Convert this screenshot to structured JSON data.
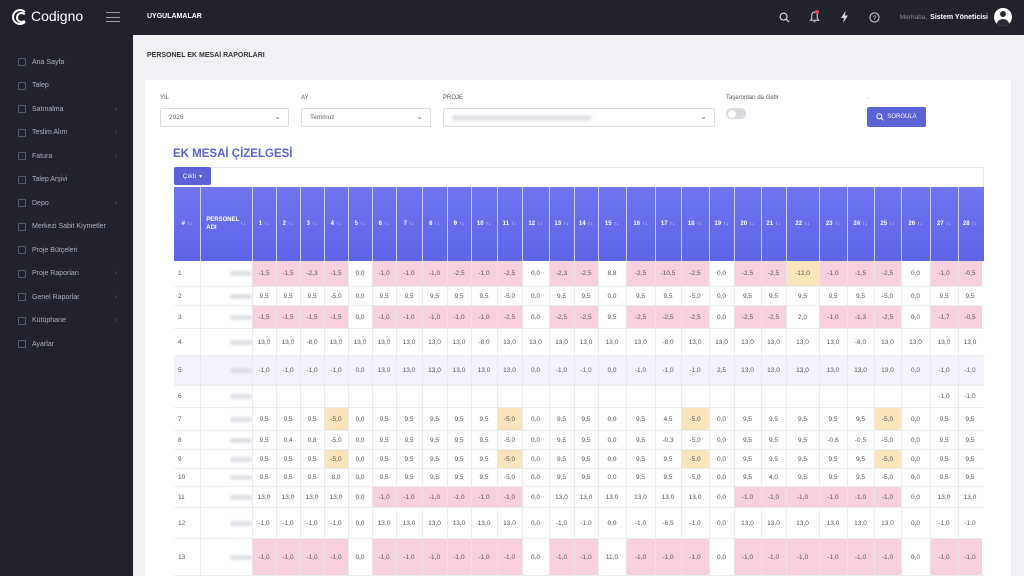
{
  "brand": {
    "name": "Codigno"
  },
  "header": {
    "menu_label": "UYGULAMALAR",
    "greeting": "Merhaba,",
    "user_name": "Sistem Yöneticisi",
    "icons": [
      "search-icon",
      "bell-icon",
      "bolt-icon",
      "help-icon"
    ]
  },
  "sidebar": {
    "items": [
      {
        "label": "Ana Sayfa",
        "has_arrow": false
      },
      {
        "label": "Talep",
        "has_arrow": false
      },
      {
        "label": "Satınalma",
        "has_arrow": true
      },
      {
        "label": "Teslim Alım",
        "has_arrow": true
      },
      {
        "label": "Fatura",
        "has_arrow": true
      },
      {
        "label": "Talep Arşivi",
        "has_arrow": false
      },
      {
        "label": "Depo",
        "has_arrow": true
      },
      {
        "label": "Merkezi Sabit Kıymetler",
        "has_arrow": false
      },
      {
        "label": "Proje Bütçeleri",
        "has_arrow": false
      },
      {
        "label": "Proje Raporları",
        "has_arrow": true
      },
      {
        "label": "Genel Raporlar",
        "has_arrow": true
      },
      {
        "label": "Kütüphane",
        "has_arrow": true
      },
      {
        "label": "Ayarlar",
        "has_arrow": false
      }
    ]
  },
  "page": {
    "title": "PERSONEL EK MESAİ RAPORLARI"
  },
  "filters": {
    "year_label": "YIL",
    "year_value": "2026",
    "month_label": "AY",
    "month_value": "Temmuz",
    "project_label": "PROJE",
    "subcontractor_label": "Taşeronları da Getir",
    "subcontractor_on": false,
    "query_button": "SORGULA"
  },
  "report": {
    "section_title": "EK MESAİ ÇİZELGESİ",
    "export_button": "Çıktı",
    "col_no": "#",
    "col_name": "PERSONEL ADI",
    "days": [
      "1",
      "2",
      "3",
      "4",
      "5",
      "6",
      "7",
      "8",
      "9",
      "10",
      "11",
      "12",
      "13",
      "14",
      "15",
      "16",
      "17",
      "18",
      "19",
      "20",
      "21",
      "22",
      "23",
      "24",
      "25",
      "26",
      "27",
      "28"
    ],
    "rows": [
      {
        "no": "1",
        "v": [
          "-1,5",
          "-1,5",
          "-2,3",
          "-1,5",
          "0,0",
          "-1,0",
          "-1,0",
          "-1,0",
          "-2,5",
          "-1,0",
          "-2,5",
          "0,0",
          "-2,3",
          "-2,5",
          "8,8",
          "-2,5",
          "-10,5",
          "-2,5",
          "0,0",
          "-2,5",
          "-2,5",
          "-12,0",
          "-1,0",
          "-1,5",
          "-2,5",
          "0,0",
          "-1,0",
          "-0,5"
        ],
        "c": [
          "n",
          "n",
          "n",
          "n",
          "",
          "n",
          "n",
          "n",
          "n",
          "n",
          "n",
          "",
          "n",
          "n",
          "",
          "n",
          "n",
          "n",
          "",
          "n",
          "n",
          "w",
          "n",
          "n",
          "n",
          "",
          "n",
          "n"
        ]
      },
      {
        "no": "2",
        "v": [
          "9,5",
          "9,5",
          "9,5",
          "-5,0",
          "0,0",
          "9,5",
          "9,5",
          "9,5",
          "9,5",
          "9,5",
          "-5,0",
          "0,0",
          "9,5",
          "9,5",
          "0,0",
          "9,5",
          "9,5",
          "-5,0",
          "0,0",
          "9,5",
          "9,5",
          "9,5",
          "9,5",
          "9,5",
          "-5,0",
          "0,0",
          "9,5",
          "9,5"
        ],
        "c": [
          "",
          "",
          "",
          "",
          "",
          "",
          "",
          "",
          "",
          "",
          "",
          "",
          "",
          "",
          "",
          "",
          "",
          "",
          "",
          "",
          "",
          "",
          "",
          "",
          "",
          "",
          "",
          ""
        ]
      },
      {
        "no": "3",
        "v": [
          "-1,5",
          "-1,5",
          "-1,5",
          "-1,5",
          "0,0",
          "-1,0",
          "-1,0",
          "-1,0",
          "-1,0",
          "-1,0",
          "-2,5",
          "0,0",
          "-2,5",
          "-2,5",
          "9,5",
          "-2,5",
          "-2,5",
          "-2,5",
          "0,0",
          "-2,5",
          "-2,5",
          "2,0",
          "-1,0",
          "-1,3",
          "-2,5",
          "0,0",
          "-1,7",
          "-0,5"
        ],
        "c": [
          "n",
          "n",
          "n",
          "n",
          "",
          "n",
          "n",
          "n",
          "n",
          "n",
          "n",
          "",
          "n",
          "n",
          "",
          "n",
          "n",
          "n",
          "",
          "n",
          "n",
          "",
          "n",
          "n",
          "n",
          "",
          "n",
          "n"
        ]
      },
      {
        "no": "4",
        "v": [
          "13,0",
          "13,0",
          "-8,0",
          "13,0",
          "13,0",
          "13,0",
          "13,0",
          "13,0",
          "13,0",
          "-8,0",
          "13,0",
          "13,0",
          "13,0",
          "13,0",
          "13,0",
          "13,0",
          "-8,0",
          "13,0",
          "13,0",
          "13,0",
          "13,0",
          "13,0",
          "13,0",
          "-8,0",
          "13,0",
          "13,0",
          "13,0",
          "13,0"
        ],
        "c": [
          "",
          "",
          "",
          "",
          "",
          "",
          "",
          "",
          "",
          "",
          "",
          "",
          "",
          "",
          "",
          "",
          "",
          "",
          "",
          "",
          "",
          "",
          "",
          "",
          "",
          "",
          "",
          ""
        ]
      },
      {
        "no": "5",
        "v": [
          "-1,0",
          "-1,0",
          "-1,0",
          "-1,0",
          "0,0",
          "13,0",
          "13,0",
          "13,0",
          "13,0",
          "13,0",
          "13,0",
          "0,0",
          "-1,0",
          "-1,0",
          "0,0",
          "-1,0",
          "-1,0",
          "-1,0",
          "2,5",
          "13,0",
          "13,0",
          "13,0",
          "13,0",
          "13,0",
          "13,0",
          "0,0",
          "-1,0",
          "-1,0"
        ],
        "c": [
          "",
          "",
          "",
          "",
          "",
          "",
          "",
          "",
          "",
          "",
          "",
          "",
          "",
          "",
          "",
          "",
          "",
          "",
          "",
          "",
          "",
          "",
          "",
          "",
          "",
          "",
          "",
          ""
        ]
      },
      {
        "no": "6",
        "v": [
          "",
          "",
          "",
          "",
          "",
          "",
          "",
          "",
          "",
          "",
          "",
          "",
          "",
          "",
          "",
          "",
          "",
          "",
          "",
          "",
          "",
          "",
          "",
          "",
          "",
          "",
          "-1,0",
          "-1,0"
        ],
        "c": [
          "",
          "",
          "",
          "",
          "",
          "",
          "",
          "",
          "",
          "",
          "",
          "",
          "",
          "",
          "",
          "",
          "",
          "",
          "",
          "",
          "",
          "",
          "",
          "",
          "",
          "",
          "",
          ""
        ]
      },
      {
        "no": "7",
        "v": [
          "9,5",
          "9,5",
          "9,5",
          "-5,0",
          "0,0",
          "9,5",
          "9,5",
          "9,5",
          "9,5",
          "9,5",
          "-5,0",
          "0,0",
          "9,5",
          "9,5",
          "0,0",
          "9,5",
          "4,5",
          "-5,0",
          "0,0",
          "9,5",
          "9,5",
          "9,5",
          "9,5",
          "9,5",
          "-5,0",
          "0,0",
          "9,5",
          "9,5"
        ],
        "c": [
          "",
          "",
          "",
          "w",
          "",
          "",
          "",
          "",
          "",
          "",
          "w",
          "",
          "",
          "",
          "",
          "",
          "",
          "w",
          "",
          "",
          "",
          "",
          "",
          "",
          "w",
          "",
          "",
          ""
        ]
      },
      {
        "no": "8",
        "v": [
          "9,5",
          "0,4",
          "0,8",
          "-5,0",
          "0,0",
          "9,5",
          "9,5",
          "9,5",
          "9,5",
          "9,5",
          "-5,0",
          "0,0",
          "9,5",
          "9,5",
          "0,0",
          "9,5",
          "-0,3",
          "-5,0",
          "0,0",
          "9,5",
          "9,5",
          "9,5",
          "-0,6",
          "-0,5",
          "-5,0",
          "0,0",
          "9,5",
          "9,5"
        ],
        "c": [
          "",
          "",
          "",
          "",
          "",
          "",
          "",
          "",
          "",
          "",
          "",
          "",
          "",
          "",
          "",
          "",
          "",
          "",
          "",
          "",
          "",
          "",
          "",
          "",
          "",
          "",
          "",
          ""
        ]
      },
      {
        "no": "9",
        "v": [
          "9,5",
          "9,5",
          "9,5",
          "-5,0",
          "0,0",
          "9,5",
          "9,5",
          "9,5",
          "9,5",
          "9,5",
          "-5,0",
          "0,0",
          "9,5",
          "9,5",
          "0,0",
          "9,5",
          "9,5",
          "-5,0",
          "0,0",
          "9,5",
          "9,5",
          "9,5",
          "9,5",
          "9,5",
          "-5,0",
          "0,0",
          "9,5",
          "9,5"
        ],
        "c": [
          "",
          "",
          "",
          "w",
          "",
          "",
          "",
          "",
          "",
          "",
          "w",
          "",
          "",
          "",
          "",
          "",
          "",
          "w",
          "",
          "",
          "",
          "",
          "",
          "",
          "w",
          "",
          "",
          ""
        ]
      },
      {
        "no": "10",
        "v": [
          "9,5",
          "9,5",
          "9,5",
          "8,0",
          "0,0",
          "9,5",
          "9,5",
          "9,5",
          "9,5",
          "9,5",
          "-5,0",
          "0,0",
          "9,5",
          "9,5",
          "0,0",
          "9,5",
          "9,5",
          "-5,0",
          "0,0",
          "9,5",
          "4,0",
          "9,5",
          "9,5",
          "9,5",
          "-5,0",
          "0,0",
          "9,5",
          "9,5"
        ],
        "c": [
          "",
          "",
          "",
          "",
          "",
          "",
          "",
          "",
          "",
          "",
          "",
          "",
          "",
          "",
          "",
          "",
          "",
          "",
          "",
          "",
          "",
          "",
          "",
          "",
          "",
          "",
          "",
          ""
        ]
      },
      {
        "no": "11",
        "v": [
          "13,0",
          "13,0",
          "13,0",
          "13,0",
          "0,0",
          "-1,0",
          "-1,0",
          "-1,0",
          "-1,0",
          "-1,0",
          "-1,0",
          "0,0",
          "13,0",
          "13,0",
          "13,0",
          "13,0",
          "13,0",
          "13,0",
          "0,0",
          "-1,0",
          "-1,0",
          "-1,0",
          "-1,0",
          "-1,0",
          "-1,0",
          "0,0",
          "13,0",
          "13,0"
        ],
        "c": [
          "",
          "",
          "",
          "",
          "",
          "n",
          "n",
          "n",
          "n",
          "n",
          "n",
          "",
          "",
          "",
          "",
          "",
          "",
          "",
          "",
          "n",
          "n",
          "n",
          "n",
          "n",
          "n",
          "",
          "",
          ""
        ]
      },
      {
        "no": "12",
        "v": [
          "-1,0",
          "-1,0",
          "-1,0",
          "-1,0",
          "0,0",
          "13,0",
          "13,0",
          "13,0",
          "13,0",
          "13,0",
          "13,0",
          "0,0",
          "-1,0",
          "-1,0",
          "0,0",
          "-1,0",
          "-8,5",
          "-1,0",
          "0,0",
          "13,0",
          "13,0",
          "13,0",
          "13,0",
          "13,0",
          "13,0",
          "0,0",
          "-1,0",
          "-1,0"
        ],
        "c": [
          "",
          "",
          "",
          "",
          "",
          "",
          "",
          "",
          "",
          "",
          "",
          "",
          "",
          "",
          "",
          "",
          "",
          "",
          "",
          "",
          "",
          "",
          "",
          "",
          "",
          "",
          "",
          ""
        ]
      },
      {
        "no": "13",
        "v": [
          "-1,0",
          "-1,0",
          "-1,0",
          "-1,0",
          "0,0",
          "-1,0",
          "-1,0",
          "-1,0",
          "-1,0",
          "-1,0",
          "-1,0",
          "0,0",
          "-1,0",
          "-1,0",
          "11,0",
          "-1,0",
          "-1,0",
          "-1,0",
          "0,0",
          "-1,0",
          "-1,0",
          "-1,0",
          "-1,0",
          "-1,0",
          "-1,0",
          "0,0",
          "-1,0",
          "-1,0"
        ],
        "c": [
          "n",
          "n",
          "n",
          "n",
          "",
          "n",
          "n",
          "n",
          "n",
          "n",
          "n",
          "",
          "n",
          "n",
          "",
          "n",
          "n",
          "n",
          "",
          "n",
          "n",
          "n",
          "n",
          "n",
          "n",
          "",
          "n",
          "n"
        ]
      }
    ]
  }
}
